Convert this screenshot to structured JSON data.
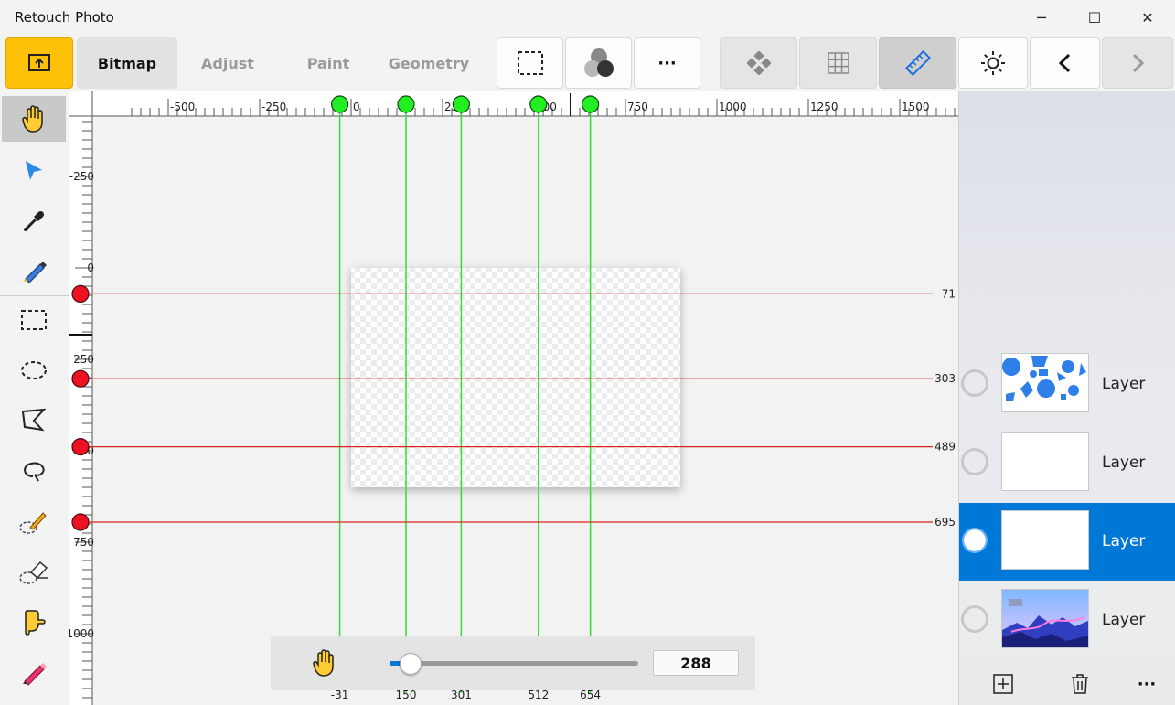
{
  "window": {
    "title": "Retouch Photo",
    "minimize_glyph": "─",
    "maximize_glyph": "☐",
    "close_glyph": "✕"
  },
  "toolbar": {
    "tabs": [
      "Bitmap",
      "Adjust",
      "Paint",
      "Geometry"
    ],
    "active_tab": "Bitmap",
    "more_glyph": "···"
  },
  "ruler": {
    "top_labels": [
      "-500",
      "-250",
      "0",
      "250",
      "500",
      "750",
      "1000",
      "1250",
      "1500"
    ],
    "left_labels": [
      "-250",
      "0",
      "250",
      "500",
      "750",
      "1000"
    ]
  },
  "guides": {
    "vertical_values": [
      "-31",
      "150",
      "301",
      "512",
      "654"
    ],
    "horizontal_values": [
      "71",
      "303",
      "489",
      "695"
    ],
    "vertical_color": "#33dd33",
    "horizontal_color": "#dd2222"
  },
  "zoom": {
    "value": "288",
    "level": 0.08
  },
  "layers": [
    {
      "name": "Layer",
      "thumb": "shapes"
    },
    {
      "name": "Layer",
      "thumb": "blank"
    },
    {
      "name": "Layer",
      "thumb": "blank",
      "selected": true
    },
    {
      "name": "Layer",
      "thumb": "photo"
    }
  ],
  "colors": {
    "accent": "#0078d7",
    "export_button": "#ffc107"
  },
  "icons": {
    "export": "export-icon",
    "crop": "crop-icon",
    "mask": "mask-icon",
    "grid": "grid-icon",
    "ruler": "ruler-icon",
    "theme": "sun-icon",
    "undo": "chevron-left-icon",
    "redo": "chevron-right-icon"
  }
}
